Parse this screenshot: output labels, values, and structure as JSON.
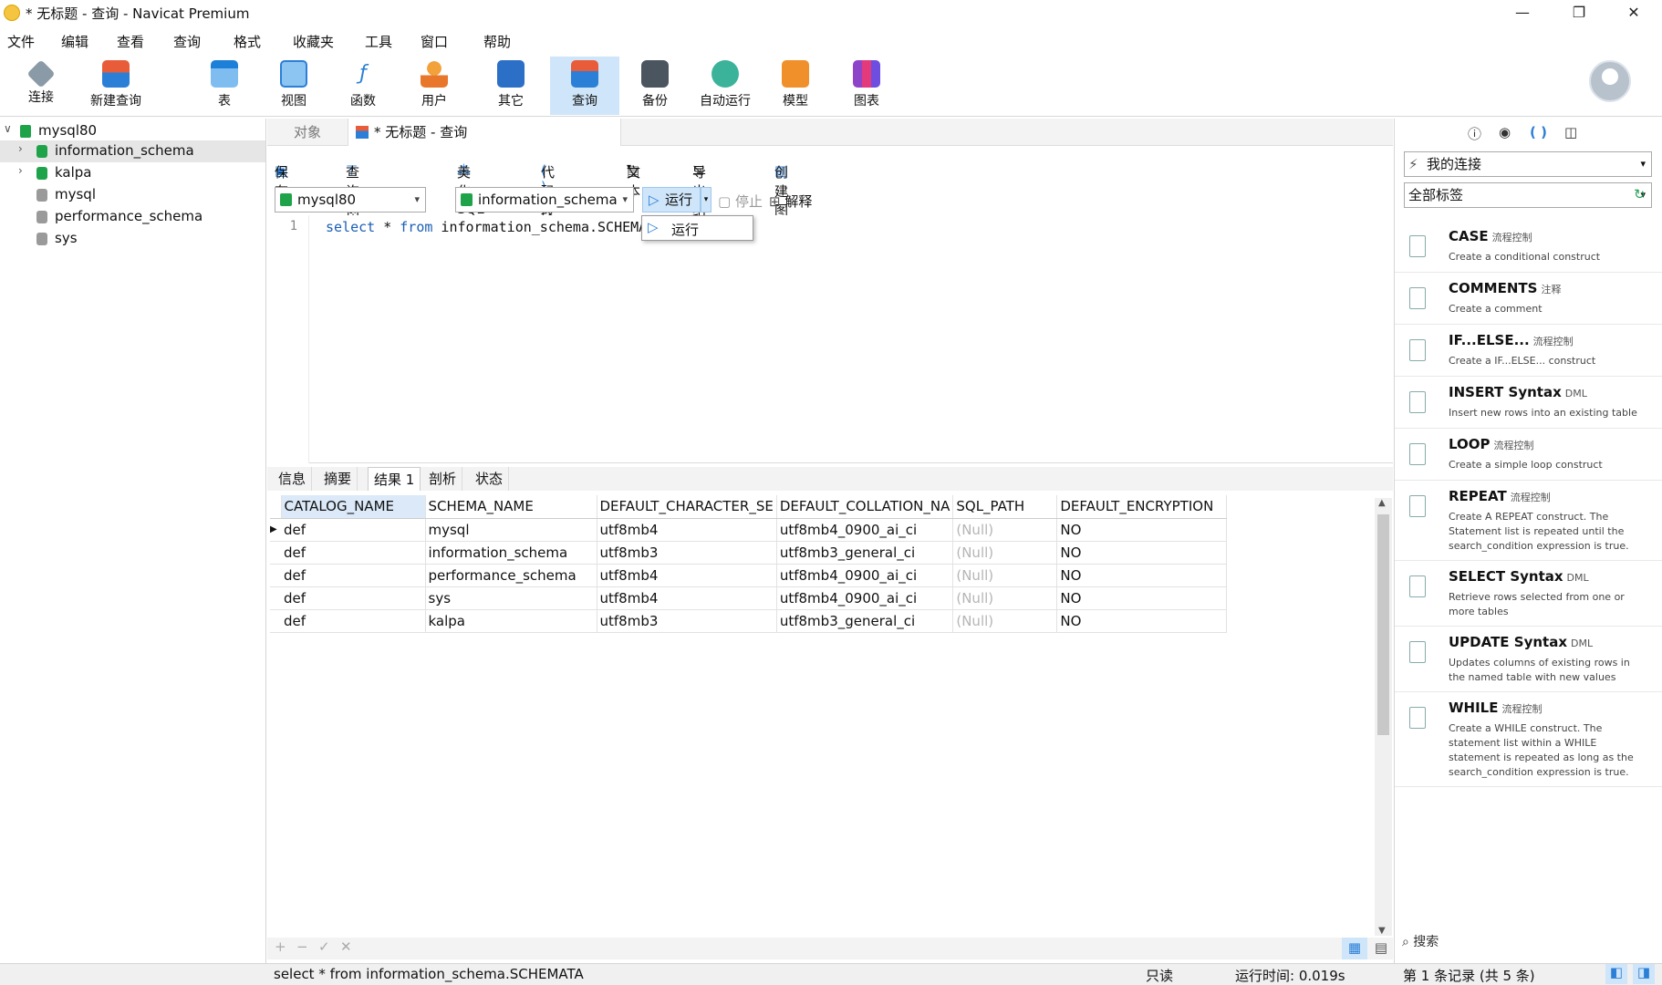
{
  "window": {
    "title": "* 无标题 - 查询 - Navicat Premium",
    "minimize": "—",
    "restore": "❐",
    "close": "✕"
  },
  "menu": [
    "文件",
    "编辑",
    "查看",
    "查询",
    "格式",
    "收藏夹",
    "工具",
    "窗口",
    "帮助"
  ],
  "toolbar": {
    "connect": "连接",
    "new_query": "新建查询",
    "table": "表",
    "view": "视图",
    "function": "函数",
    "user": "用户",
    "other": "其它",
    "query": "查询",
    "backup": "备份",
    "autorun": "自动运行",
    "model": "模型",
    "chart": "图表"
  },
  "tree": {
    "connection": "mysql80",
    "databases": [
      "information_schema",
      "kalpa",
      "mysql",
      "performance_schema",
      "sys"
    ]
  },
  "tabs": {
    "objects": "对象",
    "query_tab": "* 无标题 - 查询"
  },
  "query_toolbar": {
    "save": "保存",
    "builder": "查询创建工具",
    "beautify": "美化 SQL",
    "snippet": "代码段",
    "text": "文本",
    "export": "导出结果",
    "create_chart": "创建图表"
  },
  "selectors": {
    "connection": "mysql80",
    "database": "information_schema",
    "run": "运行",
    "stop": "停止",
    "explain": "解释"
  },
  "run_dropdown": {
    "item": "运行"
  },
  "editor": {
    "line_no": "1",
    "kw1": "select",
    "star": " * ",
    "kw2": "from",
    "rest": " information_schema.SCHEMA"
  },
  "result_tabs": [
    "信息",
    "摘要",
    "结果 1",
    "剖析",
    "状态"
  ],
  "grid": {
    "columns": [
      "CATALOG_NAME",
      "SCHEMA_NAME",
      "DEFAULT_CHARACTER_SE",
      "DEFAULT_COLLATION_NA",
      "SQL_PATH",
      "DEFAULT_ENCRYPTION"
    ],
    "rows": [
      [
        "def",
        "mysql",
        "utf8mb4",
        "utf8mb4_0900_ai_ci",
        "(Null)",
        "NO"
      ],
      [
        "def",
        "information_schema",
        "utf8mb3",
        "utf8mb3_general_ci",
        "(Null)",
        "NO"
      ],
      [
        "def",
        "performance_schema",
        "utf8mb4",
        "utf8mb4_0900_ai_ci",
        "(Null)",
        "NO"
      ],
      [
        "def",
        "sys",
        "utf8mb4",
        "utf8mb4_0900_ai_ci",
        "(Null)",
        "NO"
      ],
      [
        "def",
        "kalpa",
        "utf8mb3",
        "utf8mb3_general_ci",
        "(Null)",
        "NO"
      ]
    ]
  },
  "grid_footer": {
    "add": "+",
    "remove": "−",
    "apply": "✓",
    "discard": "✕"
  },
  "right_panel": {
    "connection_combo": "我的连接",
    "tag_combo": "全部标签",
    "search": "搜索",
    "snippets": [
      {
        "name": "CASE",
        "tag": "流程控制",
        "desc": "Create a conditional construct"
      },
      {
        "name": "COMMENTS",
        "tag": "注释",
        "desc": "Create a comment"
      },
      {
        "name": "IF...ELSE...",
        "tag": "流程控制",
        "desc": "Create a IF...ELSE... construct"
      },
      {
        "name": "INSERT Syntax",
        "tag": "DML",
        "desc": "Insert new rows into an existing table"
      },
      {
        "name": "LOOP",
        "tag": "流程控制",
        "desc": "Create a simple loop construct"
      },
      {
        "name": "REPEAT",
        "tag": "流程控制",
        "desc": "Create A REPEAT construct. The Statement list is repeated until the search_condition expression is true."
      },
      {
        "name": "SELECT Syntax",
        "tag": "DML",
        "desc": "Retrieve rows selected from one or more tables"
      },
      {
        "name": "UPDATE Syntax",
        "tag": "DML",
        "desc": "Updates columns of existing rows in the named table with new values"
      },
      {
        "name": "WHILE",
        "tag": "流程控制",
        "desc": "Create a WHILE construct. The statement list within a WHILE statement is repeated as long as the search_condition expression is true."
      }
    ]
  },
  "status": {
    "sql": "select * from information_schema.SCHEMATA",
    "readonly": "只读",
    "runtime": "运行时间: 0.019s",
    "records": "第 1 条记录 (共 5 条)"
  },
  "colors": {
    "accent": "#1a5fb4",
    "selected_tab": "#cfe5f9",
    "db_green": "#1fa34a"
  }
}
